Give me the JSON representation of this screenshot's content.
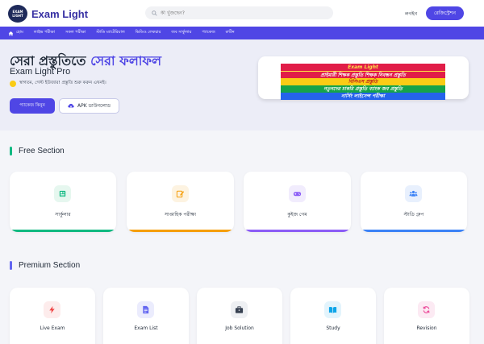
{
  "header": {
    "logo_badge": "EXAM LIGHT",
    "logo_text": "Exam Light",
    "search_placeholder": "কী খুঁজছেন?",
    "login_label": "লগইন",
    "register_label": "রেজিস্ট্রেশন"
  },
  "nav": {
    "items": [
      {
        "label": "হোম",
        "icon": "home-icon"
      },
      {
        "label": "লাইভ পরীক্ষা"
      },
      {
        "label": "সকল পরীক্ষা"
      },
      {
        "label": "স্টাডি ম্যাটেরিয়াল"
      },
      {
        "label": "ভিডিও লেকচার"
      },
      {
        "label": "জব সার্কুলার"
      },
      {
        "label": "প্যাকেজ"
      },
      {
        "label": "রুটিন"
      }
    ]
  },
  "hero": {
    "title_main": "সেরা প্রস্তুতিতে ",
    "title_accent": "সেরা ফলাফল",
    "subtitle": "Exam Light Pro",
    "greeting": "স্বাগতম, গেস্ট ইউজার! প্রস্তুতি শুরু করুন এখনই।",
    "package_button": "প্যাকেজ কিনুন",
    "apk_button": "APK ডাউনলোড",
    "banner": {
      "line1": "Exam Light",
      "line2": "প্রাইমারী শিক্ষক প্রস্তুতি   শিক্ষক নিবন্ধন প্রস্তুতি",
      "line3": "বিসিএস প্রস্তুতি",
      "line4": "নতুনদের চাকরি প্রস্তুতি   ব্যাংক জব প্রস্তুতি",
      "line5": "নার্সিং লাইসেন্স পরীক্ষা"
    }
  },
  "free_section": {
    "title": "Free Section",
    "cards": [
      {
        "label": "সার্কুলার",
        "icon": "newspaper-icon",
        "color": "#10b981",
        "bg": "#e6f7ef"
      },
      {
        "label": "সাপ্তাহিক পরীক্ষা",
        "icon": "edit-icon",
        "color": "#f59e0b",
        "bg": "#fdf3e1"
      },
      {
        "label": "কুইজ গেম",
        "icon": "gamepad-icon",
        "color": "#8b5cf6",
        "bg": "#f1ecfd"
      },
      {
        "label": "স্টাডি গ্রুপ",
        "icon": "users-icon",
        "color": "#3b82f6",
        "bg": "#e8f0fd"
      }
    ]
  },
  "premium_section": {
    "title": "Premium Section",
    "cards": [
      {
        "label": "Live Exam",
        "icon": "bolt-icon",
        "color": "#ef4444",
        "bg": "#fdecec"
      },
      {
        "label": "Exam List",
        "icon": "file-list-icon",
        "color": "#6366f1",
        "bg": "#ebecfd"
      },
      {
        "label": "Job Solution",
        "icon": "briefcase-icon",
        "color": "#374151",
        "bg": "#eef0f3"
      },
      {
        "label": "Study",
        "icon": "book-icon",
        "color": "#0ea5e9",
        "bg": "#e3f4fc"
      },
      {
        "label": "Revision",
        "icon": "sync-icon",
        "color": "#ec4899",
        "bg": "#fceaf3"
      }
    ]
  }
}
